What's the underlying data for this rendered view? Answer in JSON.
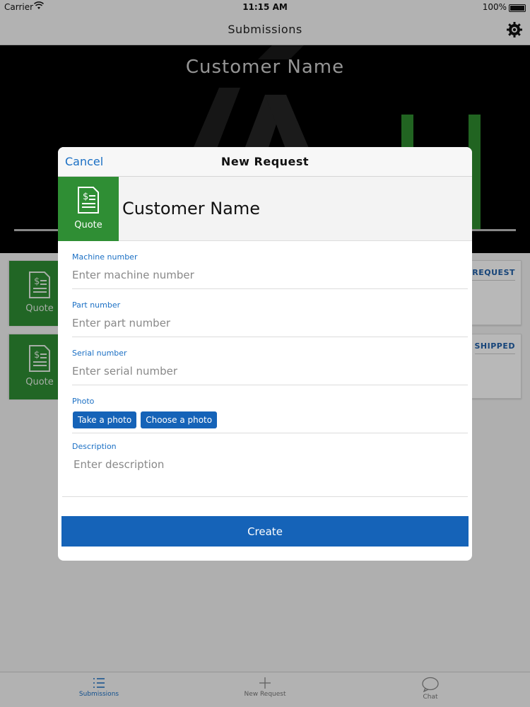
{
  "status_bar": {
    "carrier": "Carrier",
    "time": "11:15 AM",
    "battery": "100%"
  },
  "nav": {
    "title": "Submissions"
  },
  "hero": {
    "title": "Customer Name"
  },
  "background_cards": [
    {
      "tile_label": "Quote",
      "status": "REQUEST"
    },
    {
      "tile_label": "Quote",
      "status": "SHIPPED"
    }
  ],
  "modal": {
    "cancel_label": "Cancel",
    "title": "New Request",
    "customer_tile_label": "Quote",
    "customer_name": "Customer Name",
    "fields": {
      "machine_label": "Machine number",
      "machine_placeholder": "Enter machine number",
      "part_label": "Part number",
      "part_placeholder": "Enter part number",
      "serial_label": "Serial number",
      "serial_placeholder": "Enter serial number",
      "photo_label": "Photo",
      "take_photo_label": "Take a photo",
      "choose_photo_label": "Choose a photo",
      "description_label": "Description",
      "description_placeholder": "Enter description"
    },
    "create_label": "Create"
  },
  "tabs": [
    {
      "label": "Submissions",
      "icon": "list-icon",
      "active": true
    },
    {
      "label": "New Request",
      "icon": "plus-icon",
      "active": false
    },
    {
      "label": "Chat",
      "icon": "chat-icon",
      "active": false
    }
  ],
  "colors": {
    "accent": "#1563b8",
    "tile_green": "#2f8e34",
    "link_blue": "#1a6fc4"
  }
}
